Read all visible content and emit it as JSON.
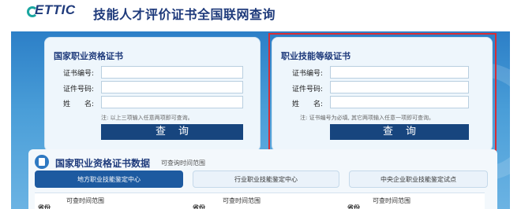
{
  "header": {
    "logo_text": "ETTIC",
    "site_title": "技能人才评价证书全国联网查询"
  },
  "left_card": {
    "title": "国家职业资格证书",
    "fields": [
      {
        "label": "证书编号:",
        "value": ""
      },
      {
        "label": "证件号码:",
        "value": ""
      },
      {
        "label": "姓　　名:",
        "value": ""
      }
    ],
    "note": "注: 以上三项输入任意两项即可查询。",
    "button": "查询"
  },
  "right_card": {
    "title": "职业技能等级证书",
    "fields": [
      {
        "label": "证书编号:",
        "value": ""
      },
      {
        "label": "证件号码:",
        "value": ""
      },
      {
        "label": "姓　　名:",
        "value": ""
      }
    ],
    "note": "注: 证书编号为必填, 其它两项输入任意一项即可查询。",
    "button": "查询"
  },
  "data_section": {
    "title": "国家职业资格证书数据",
    "subtitle": "可查询时间范围",
    "tabs": [
      {
        "label": "地方职业技能鉴定中心",
        "active": true
      },
      {
        "label": "行业职业技能鉴定中心",
        "active": false
      },
      {
        "label": "中央企业职业技能鉴定试点",
        "active": false
      }
    ],
    "column_headers": [
      "可查时间范围",
      "可查时间范围",
      "可查时间范围"
    ],
    "cut_label": "省份"
  },
  "colors": {
    "brand": "#1e3a7b",
    "banner": "#4a9ed8",
    "button": "#17457e",
    "highlight": "#d72d35"
  }
}
